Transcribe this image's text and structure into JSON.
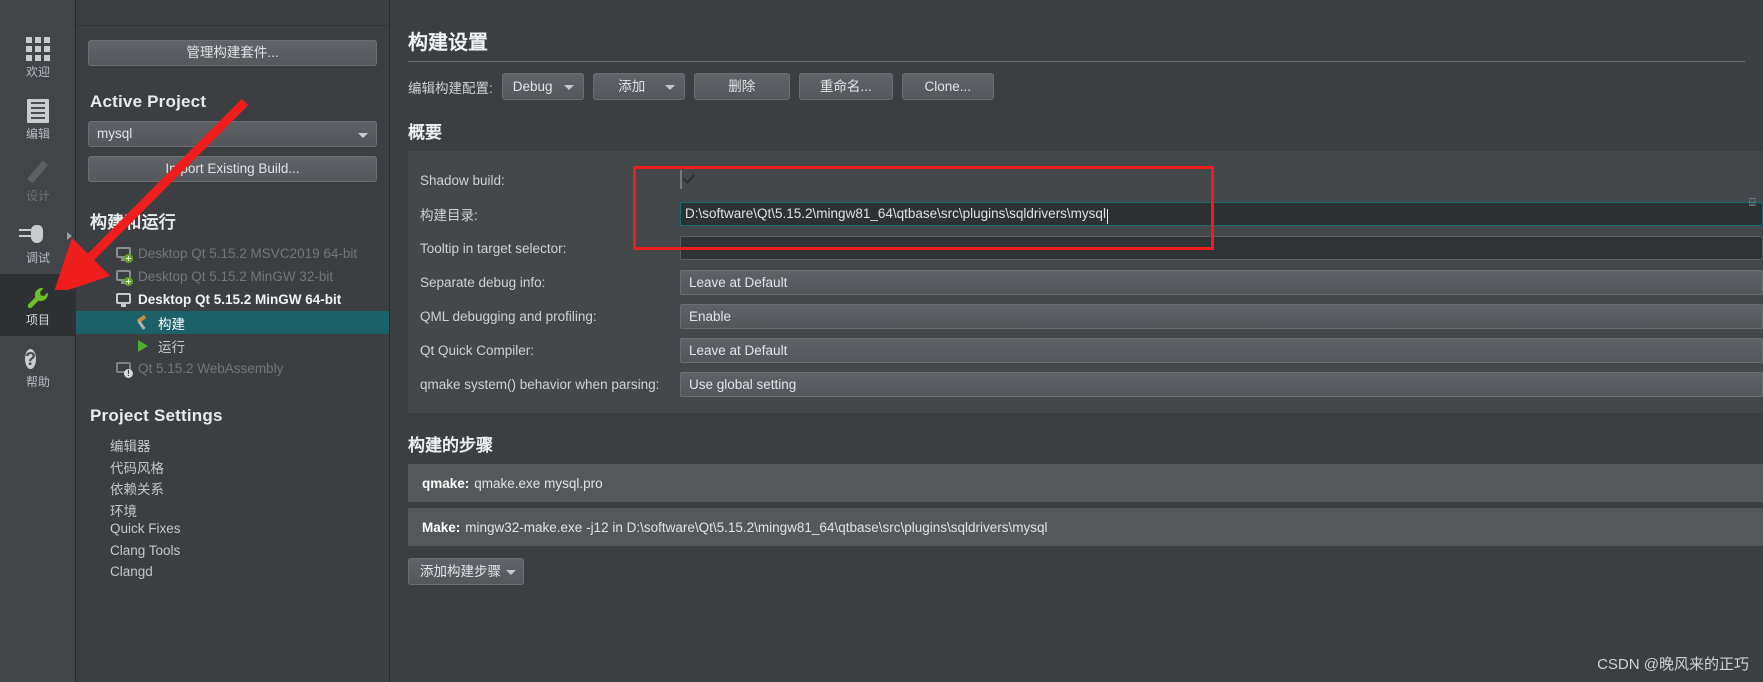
{
  "modebar": {
    "items": [
      {
        "label": "欢迎",
        "icon": "grid-icon",
        "state": "normal"
      },
      {
        "label": "编辑",
        "icon": "document-icon",
        "state": "normal"
      },
      {
        "label": "设计",
        "icon": "pencil-icon",
        "state": "disabled"
      },
      {
        "label": "调试",
        "icon": "bug-icon",
        "state": "normal"
      },
      {
        "label": "项目",
        "icon": "wrench-icon",
        "state": "active"
      },
      {
        "label": "帮助",
        "icon": "question-icon",
        "state": "normal"
      }
    ]
  },
  "sidebar": {
    "manage_kits_button": "管理构建套件...",
    "active_project_title": "Active Project",
    "project_combo_value": "mysql",
    "import_build_button": "Import Existing Build...",
    "build_and_run_title": "构建和运行",
    "kits": [
      {
        "label": "Desktop Qt 5.15.2 MSVC2019 64-bit",
        "icon": "kit-add-icon",
        "state": "disabled"
      },
      {
        "label": "Desktop Qt 5.15.2 MinGW 32-bit",
        "icon": "kit-add-icon",
        "state": "disabled"
      },
      {
        "label": "Desktop Qt 5.15.2 MinGW 64-bit",
        "icon": "kit-icon",
        "state": "active"
      }
    ],
    "kit_children": [
      {
        "label": "构建",
        "icon": "hammer-icon",
        "selected": true
      },
      {
        "label": "运行",
        "icon": "play-icon",
        "selected": false
      }
    ],
    "webassembly_kit": {
      "label": "Qt 5.15.2 WebAssembly",
      "icon": "kit-warning-icon"
    },
    "project_settings_title": "Project Settings",
    "settings_items": [
      "编辑器",
      "代码风格",
      "依赖关系",
      "环境",
      "Quick Fixes",
      "Clang Tools",
      "Clangd"
    ]
  },
  "main": {
    "title": "构建设置",
    "edit_config_label": "编辑构建配置:",
    "config_combo_value": "Debug",
    "add_button": "添加",
    "delete_button": "删除",
    "rename_button": "重命名...",
    "clone_button": "Clone...",
    "summary_title": "概要",
    "rows": [
      {
        "label": "Shadow build:",
        "type": "checkbox",
        "checked": true
      },
      {
        "label": "构建目录:",
        "type": "lineedit-focused",
        "value": "D:\\software\\Qt\\5.15.2\\mingw81_64\\qtbase\\src\\plugins\\sqldrivers\\mysql"
      },
      {
        "label": "Tooltip in target selector:",
        "type": "lineedit",
        "value": ""
      },
      {
        "label": "Separate debug info:",
        "type": "combo",
        "value": "Leave at Default"
      },
      {
        "label": "QML debugging and profiling:",
        "type": "combo",
        "value": "Enable"
      },
      {
        "label": "Qt Quick Compiler:",
        "type": "combo",
        "value": "Leave at Default"
      },
      {
        "label": "qmake system() behavior when parsing:",
        "type": "combo",
        "value": "Use global setting"
      }
    ],
    "build_steps_title": "构建的步骤",
    "steps": [
      {
        "name": "qmake:",
        "detail": "qmake.exe mysql.pro"
      },
      {
        "name": "Make:",
        "detail": "mingw32-make.exe -j12 in D:\\software\\Qt\\5.15.2\\mingw81_64\\qtbase\\src\\plugins\\sqldrivers\\mysql"
      }
    ],
    "add_step_button": "添加构建步骤"
  },
  "overlay": {
    "watermark": "CSDN @晚风来的正巧",
    "annotation_color": "#f01d1d"
  }
}
